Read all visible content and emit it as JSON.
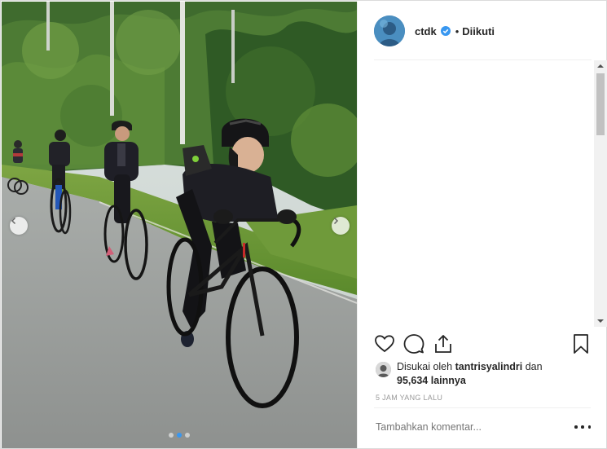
{
  "post": {
    "username": "ctdk",
    "verified": true,
    "bullet": "•",
    "follow_status": "Diikuti"
  },
  "media": {
    "description_icon": "photo-of-cyclists",
    "carousel": {
      "count": 3,
      "active_index": 1
    },
    "prev_icon": "chevron-left-icon",
    "next_icon": "chevron-right-icon"
  },
  "actions": {
    "like_icon": "heart-icon",
    "comment_icon": "comment-icon",
    "share_icon": "share-icon",
    "save_icon": "bookmark-icon"
  },
  "likes": {
    "prefix": "Disukai oleh",
    "liker": "tantrisyalindri",
    "conjunction": "dan",
    "count": "95,634",
    "suffix": "lainnya"
  },
  "timestamp": "5 JAM YANG LALU",
  "comment_box": {
    "placeholder": "Tambahkan komentar..."
  },
  "colors": {
    "accent": "#3897f0",
    "text": "#262626",
    "muted": "#999999",
    "border": "#efefef"
  }
}
